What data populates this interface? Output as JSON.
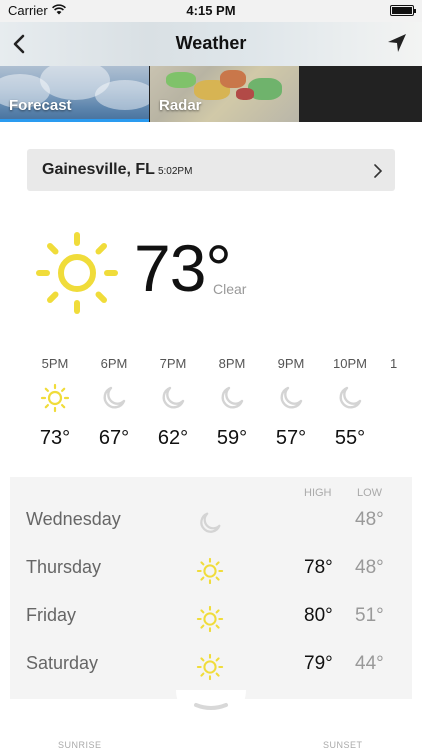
{
  "status_bar": {
    "carrier": "Carrier",
    "time": "4:15 PM"
  },
  "nav": {
    "title": "Weather"
  },
  "tabs": [
    {
      "label": "Forecast",
      "selected": true
    },
    {
      "label": "Radar",
      "selected": false
    }
  ],
  "location": {
    "city": "Gainesville, FL",
    "time": "5:02PM"
  },
  "current": {
    "temp": "73°",
    "condition": "Clear",
    "icon": "sun-icon"
  },
  "hourly": [
    {
      "time": "5PM",
      "icon": "sun-icon",
      "temp": "73°"
    },
    {
      "time": "6PM",
      "icon": "moon-icon",
      "temp": "67°"
    },
    {
      "time": "7PM",
      "icon": "moon-icon",
      "temp": "62°"
    },
    {
      "time": "8PM",
      "icon": "moon-icon",
      "temp": "59°"
    },
    {
      "time": "9PM",
      "icon": "moon-icon",
      "temp": "57°"
    },
    {
      "time": "10PM",
      "icon": "moon-icon",
      "temp": "55°"
    },
    {
      "time": "1",
      "icon": "",
      "temp": ""
    }
  ],
  "daily": {
    "high_label": "HIGH",
    "low_label": "LOW",
    "days": [
      {
        "name": "Wednesday",
        "icon": "moon-icon",
        "high": "",
        "low": "48°"
      },
      {
        "name": "Thursday",
        "icon": "sun-icon",
        "high": "78°",
        "low": "48°"
      },
      {
        "name": "Friday",
        "icon": "sun-icon",
        "high": "80°",
        "low": "51°"
      },
      {
        "name": "Saturday",
        "icon": "sun-icon",
        "high": "79°",
        "low": "44°"
      }
    ]
  },
  "sun_times": {
    "sunrise_label": "SUNRISE",
    "sunset_label": "SUNSET"
  },
  "colors": {
    "sun": "#f0dc3a",
    "moon": "#d4d4d4",
    "tab_accent": "#2a9bf0"
  }
}
